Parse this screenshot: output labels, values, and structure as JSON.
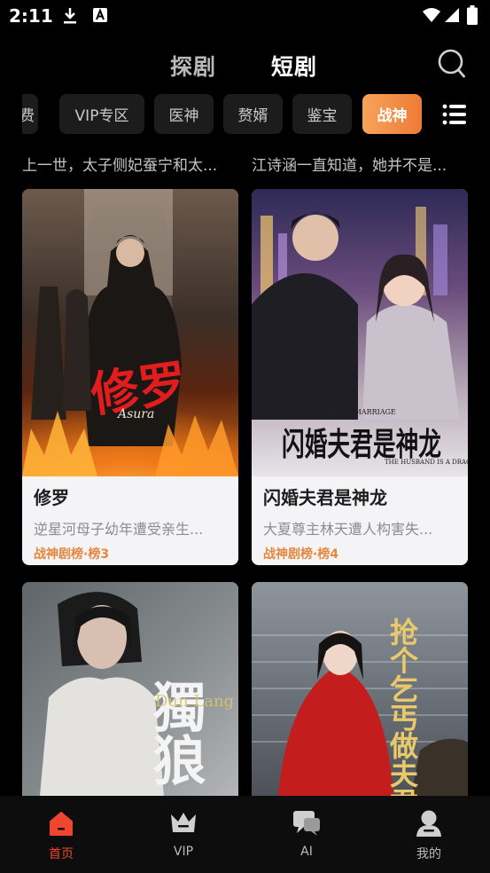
{
  "status_bar": {
    "time": "2:11"
  },
  "header": {
    "tabs": [
      {
        "label": "探剧"
      },
      {
        "label": "短剧"
      }
    ]
  },
  "chips": [
    {
      "label": "费"
    },
    {
      "label": "VIP专区"
    },
    {
      "label": "医神"
    },
    {
      "label": "赘婿"
    },
    {
      "label": "鉴宝"
    },
    {
      "label": "战神"
    }
  ],
  "descriptions": [
    "上一世，太子侧妃蚕宁和太...",
    "江诗涵一直知道，她并不是..."
  ],
  "cards": [
    {
      "title": "修罗",
      "desc": "逆星河母子幼年遭受亲生...",
      "rank": "战神剧榜·榜3",
      "poster_text": "修罗",
      "poster_sub": "Asura"
    },
    {
      "title": "闪婚夫君是神龙",
      "desc": "大夏尊主林天遭人构害失...",
      "rank": "战神剧榜·榜4",
      "poster_text": "闪婚夫君是神龙",
      "poster_sub1": "FLASH MARRIAGE",
      "poster_sub2": "THE HUSBAND IS A DRAGON"
    },
    {
      "poster_text": "獨狼",
      "poster_sub": "Dun Lang"
    },
    {
      "poster_text": "抢个乞丐做夫君"
    }
  ],
  "bottom_nav": [
    {
      "label": "首页",
      "icon": "home-icon",
      "active": true
    },
    {
      "label": "VIP",
      "icon": "crown-icon",
      "active": false
    },
    {
      "label": "AI",
      "icon": "chat-icon",
      "active": false
    },
    {
      "label": "我的",
      "icon": "profile-icon",
      "active": false
    }
  ],
  "colors": {
    "accent": "#f0452e",
    "chip_active": "#ee7b36",
    "rank": "#e5873e"
  }
}
